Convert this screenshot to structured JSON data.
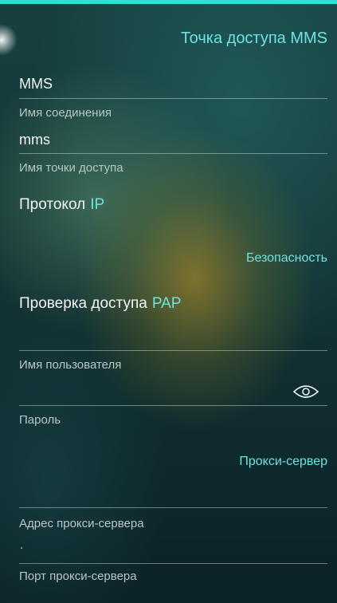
{
  "header": {
    "title": "Точка доступа MMS"
  },
  "fields": {
    "connection_name": {
      "value": "MMS",
      "label": "Имя соединения"
    },
    "apn": {
      "value": "mms",
      "label": "Имя точки доступа"
    },
    "username": {
      "value": "",
      "label": "Имя пользователя"
    },
    "password": {
      "value": "",
      "label": "Пароль",
      "toggle_icon": "eye-icon"
    },
    "proxy_address": {
      "value": "",
      "label": "Адрес прокси-сервера"
    },
    "proxy_port": {
      "value": "",
      "label": "Порт прокси-сервера"
    }
  },
  "protocol": {
    "label": "Протокол",
    "value": "IP"
  },
  "security": {
    "section_title": "Безопасность"
  },
  "auth": {
    "label": "Проверка доступа",
    "value": "PAP"
  },
  "proxy": {
    "section_title": "Прокси-сервер"
  },
  "colors": {
    "accent": "#6fe3df",
    "top_bar": "#2ee0d6"
  }
}
